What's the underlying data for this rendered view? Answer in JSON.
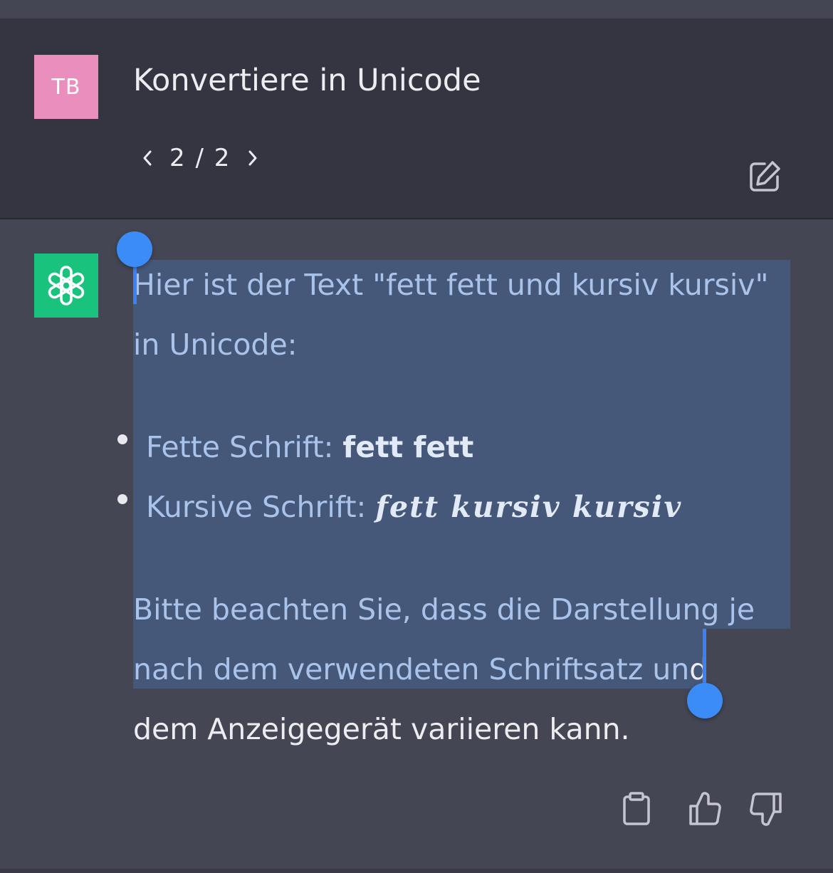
{
  "user_message": {
    "avatar_initials": "TB",
    "text": "Konvertiere in Unicode",
    "pager": {
      "label": "2 / 2"
    }
  },
  "assistant_message": {
    "line1": "Hier ist der Text \"fett fett und kursiv kursiv\"",
    "line2": "in Unicode:",
    "bullets": [
      {
        "label": "Fette Schrift: ",
        "value": "𝗳𝗲𝘁𝘁 𝗳𝗲𝘁𝘁"
      },
      {
        "label": "Kursive Schrift: ",
        "value": "𝒇𝒆𝒕𝒕 𝒌𝒖𝒓𝒔𝒊𝒗 𝒌𝒖𝒓𝒔𝒊𝒗"
      }
    ],
    "note_line1": "Bitte beachten Sie, dass die Darstellung je",
    "note_line2a": "nach dem verwendeten Schriftsatz un",
    "note_line2b": "d",
    "note_line3": "dem Anzeigegerät variieren kann."
  },
  "colors": {
    "user_bg": "#343541",
    "assistant_bg": "#444654",
    "user_avatar": "#ea8ebd",
    "bot_avatar": "#19c37d",
    "selection": "#45587a",
    "selection_handle": "#3b8cf7"
  },
  "icons": {
    "edit": "edit-icon",
    "copy": "clipboard-icon",
    "like": "thumbs-up-icon",
    "dislike": "thumbs-down-icon"
  }
}
